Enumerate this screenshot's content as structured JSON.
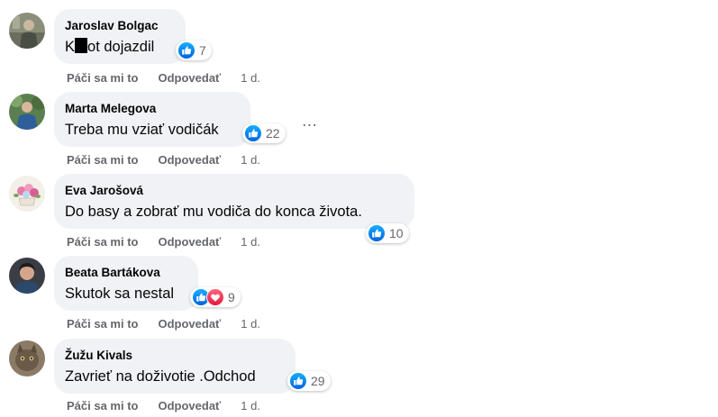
{
  "comments": [
    {
      "author": "Jaroslav Bolgac",
      "text_before": "K",
      "text_after": "ot dojazdil",
      "reactions": [
        "like"
      ],
      "reaction_count": "7",
      "like_label": "Páči sa mi to",
      "reply_label": "Odpovedať",
      "time": "1 d."
    },
    {
      "author": "Marta Melegova",
      "text": "Treba mu vziať vodičák",
      "reactions": [
        "like"
      ],
      "reaction_count": "22",
      "like_label": "Páči sa mi to",
      "reply_label": "Odpovedať",
      "time": "1 d.",
      "more_icon": "…"
    },
    {
      "author": "Eva Jarošová",
      "text": "Do basy a zobrať mu vodiča do konca života.",
      "reactions": [
        "like"
      ],
      "reaction_count": "10",
      "like_label": "Páči sa mi to",
      "reply_label": "Odpovedať",
      "time": "1 d."
    },
    {
      "author": "Beata Bartákova",
      "text": "Skutok sa nestal",
      "reactions": [
        "like",
        "love"
      ],
      "reaction_count": "9",
      "like_label": "Páči sa mi to",
      "reply_label": "Odpovedať",
      "time": "1 d."
    },
    {
      "author": "Žužu Kivals",
      "text": "Zavrieť na doživotie .Odchod",
      "reactions": [
        "like"
      ],
      "reaction_count": "29",
      "like_label": "Páči sa mi to",
      "reply_label": "Odpovedať",
      "time": "1 d."
    }
  ],
  "colors": {
    "bubble": "#f0f2f5",
    "like_blue": "#1877f2",
    "love_red": "#f33e58",
    "secondary_text": "#65676b"
  }
}
